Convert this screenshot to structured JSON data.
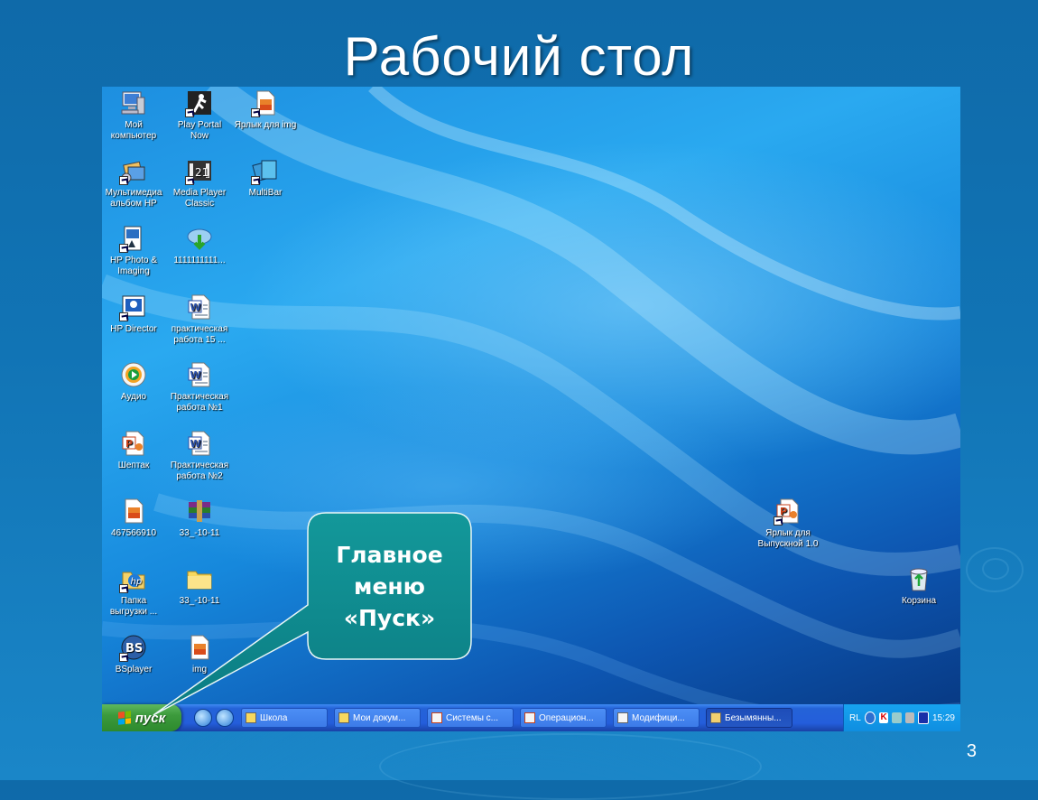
{
  "slide": {
    "title": "Рабочий стол",
    "page_number": "3",
    "callout": "Главное\nменю\n«Пуск»"
  },
  "desktop_icons": [
    {
      "id": "my-computer",
      "label": "Мой\nкомпьютер",
      "icon": "computer-icon",
      "shortcut": false
    },
    {
      "id": "play-portal",
      "label": "Play Portal\nNow",
      "icon": "play-portal-icon",
      "shortcut": true
    },
    {
      "id": "img-shortcut",
      "label": "Ярлык для img",
      "icon": "image-file-icon",
      "shortcut": true
    },
    {
      "id": "hp-album",
      "label": "Мультимедиа\nальбом HP",
      "icon": "multimedia-album-icon",
      "shortcut": true
    },
    {
      "id": "media-player",
      "label": "Media Player\nClassic",
      "icon": "media-player-icon",
      "shortcut": true
    },
    {
      "id": "multibar",
      "label": "MultiBar",
      "icon": "multibar-icon",
      "shortcut": true
    },
    {
      "id": "hp-photo",
      "label": "HP Photo &\nImaging",
      "icon": "hp-photo-icon",
      "shortcut": true
    },
    {
      "id": "download-file",
      "label": "1111111111...",
      "icon": "download-icon",
      "shortcut": false
    },
    {
      "id": "hp-director",
      "label": "HP Director",
      "icon": "hp-director-icon",
      "shortcut": true
    },
    {
      "id": "practical-15",
      "label": "практическая\nработа 15 ...",
      "icon": "word-doc-icon",
      "shortcut": false
    },
    {
      "id": "audio",
      "label": "Аудио",
      "icon": "audio-icon",
      "shortcut": false
    },
    {
      "id": "practical-1",
      "label": "Практическая\nработа №1",
      "icon": "word-doc-icon",
      "shortcut": false
    },
    {
      "id": "sheptak",
      "label": "Шептак",
      "icon": "powerpoint-icon",
      "shortcut": false
    },
    {
      "id": "practical-2",
      "label": "Практическая\nработа №2",
      "icon": "word-doc-icon",
      "shortcut": false
    },
    {
      "id": "file-467566910",
      "label": "467566910",
      "icon": "image-file-icon",
      "shortcut": false
    },
    {
      "id": "archive-33",
      "label": "33_-10-11",
      "icon": "winrar-archive-icon",
      "shortcut": false
    },
    {
      "id": "hp-upload",
      "label": "Папка\nвыгрузки ...",
      "icon": "hp-folder-icon",
      "shortcut": true
    },
    {
      "id": "folder-33",
      "label": "33_-10-11",
      "icon": "folder-icon",
      "shortcut": false
    },
    {
      "id": "bsplayer",
      "label": "BSplayer",
      "icon": "bsplayer-icon",
      "shortcut": true
    },
    {
      "id": "img",
      "label": "img",
      "icon": "image-file-icon",
      "shortcut": false
    },
    {
      "id": "graduation-shortcut",
      "label": "Ярлык для\nВыпускной 1.0",
      "icon": "powerpoint-icon",
      "shortcut": true
    },
    {
      "id": "recycle-bin",
      "label": "Корзина",
      "icon": "recycle-bin-icon",
      "shortcut": false
    }
  ],
  "taskbar": {
    "start_label": "пуск",
    "tasks": [
      {
        "label": "Школа",
        "icon": "folder-icon",
        "active": false
      },
      {
        "label": "Мои докум...",
        "icon": "folder-icon",
        "active": false
      },
      {
        "label": "Системы с...",
        "icon": "powerpoint-icon",
        "active": false
      },
      {
        "label": "Операцион...",
        "icon": "powerpoint-icon",
        "active": false
      },
      {
        "label": "Модифици...",
        "icon": "word-doc-icon",
        "active": false
      },
      {
        "label": "Безымянны...",
        "icon": "paint-icon",
        "active": true
      }
    ],
    "tray": {
      "language": "RL",
      "clock": "15:29"
    }
  },
  "colors": {
    "callout_fill": "#0f8a8f",
    "start_green": "#3c9a3c",
    "taskbar_blue": "#245edb"
  }
}
